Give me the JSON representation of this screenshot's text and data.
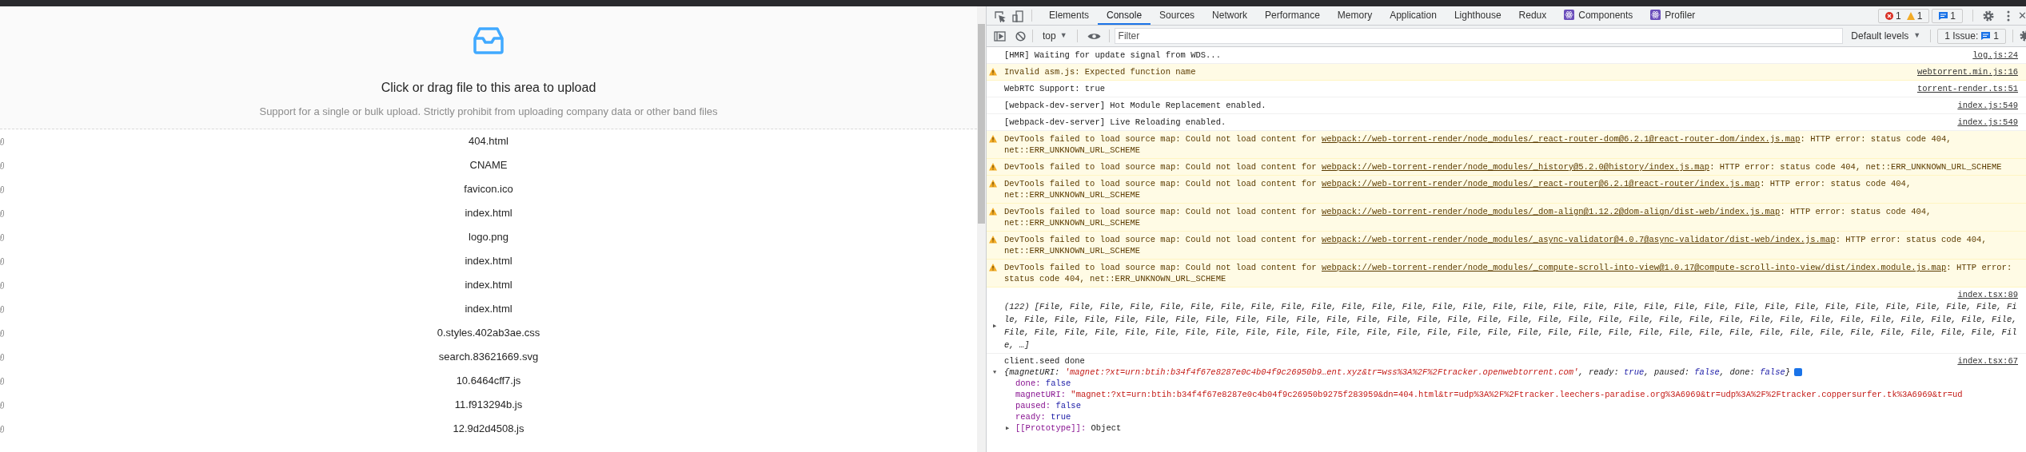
{
  "upload": {
    "title": "Click or drag file to this area to upload",
    "hint": "Support for a single or bulk upload. Strictly prohibit from uploading company data or other band files"
  },
  "files": [
    "404.html",
    "CNAME",
    "favicon.ico",
    "index.html",
    "logo.png",
    "index.html",
    "index.html",
    "index.html",
    "0.styles.402ab3ae.css",
    "search.83621669.svg",
    "10.6464cff7.js",
    "11.f913294b.js",
    "12.9d2d4508.js"
  ],
  "devtools": {
    "tabs": [
      {
        "label": "Elements",
        "kind": "plain",
        "selected": false
      },
      {
        "label": "Console",
        "kind": "plain",
        "selected": true
      },
      {
        "label": "Sources",
        "kind": "plain",
        "selected": false
      },
      {
        "label": "Network",
        "kind": "plain",
        "selected": false
      },
      {
        "label": "Performance",
        "kind": "plain",
        "selected": false
      },
      {
        "label": "Memory",
        "kind": "plain",
        "selected": false
      },
      {
        "label": "Application",
        "kind": "plain",
        "selected": false
      },
      {
        "label": "Lighthouse",
        "kind": "plain",
        "selected": false
      },
      {
        "label": "Redux",
        "kind": "plain",
        "selected": false
      },
      {
        "label": "Components",
        "kind": "react",
        "selected": false
      },
      {
        "label": "Profiler",
        "kind": "react",
        "selected": false
      }
    ],
    "counts": {
      "errors": "1",
      "warnings": "1",
      "messages": "1"
    },
    "toolbar": {
      "context": "top",
      "dropdown_caret": "▼",
      "filter_placeholder": "Filter",
      "levels": "Default levels",
      "issues_label": "1 Issue:",
      "issues_count": "1"
    },
    "close": "✕",
    "messages": [
      {
        "kind": "log",
        "text": "[HMR] Waiting for update signal from WDS...",
        "source": "log.js:24"
      },
      {
        "kind": "warning",
        "text": "Invalid asm.js: Expected function name",
        "source": "webtorrent.min.js:16"
      },
      {
        "kind": "log",
        "text": "WebRTC Support: true",
        "source": "torrent-render.ts:51"
      },
      {
        "kind": "log",
        "text": "[webpack-dev-server] Hot Module Replacement enabled.",
        "source": "index.js:549"
      },
      {
        "kind": "log",
        "text": "[webpack-dev-server] Live Reloading enabled.",
        "source": "index.js:549"
      },
      {
        "kind": "warning",
        "text": "DevTools failed to load source map: Could not load content for ",
        "link": "webpack://web-torrent-render/node_modules/_react-router-dom@6.2.1@react-router-dom/index.js.map",
        "after": ": HTTP error: status code 404, net::ERR_UNKNOWN_URL_SCHEME"
      },
      {
        "kind": "warning",
        "text": "DevTools failed to load source map: Could not load content for ",
        "link": "webpack://web-torrent-render/node_modules/_history@5.2.0@history/index.js.map",
        "after": ": HTTP error: status code 404, net::ERR_UNKNOWN_URL_SCHEME"
      },
      {
        "kind": "warning",
        "text": "DevTools failed to load source map: Could not load content for ",
        "link": "webpack://web-torrent-render/node_modules/_react-router@6.2.1@react-router/index.js.map",
        "after": ": HTTP error: status code 404, net::ERR_UNKNOWN_URL_SCHEME"
      },
      {
        "kind": "warning",
        "text": "DevTools failed to load source map: Could not load content for ",
        "link": "webpack://web-torrent-render/node_modules/_dom-align@1.12.2@dom-align/dist-web/index.js.map",
        "after": ": HTTP error: status code 404, net::ERR_UNKNOWN_URL_SCHEME"
      },
      {
        "kind": "warning",
        "text": "DevTools failed to load source map: Could not load content for ",
        "link": "webpack://web-torrent-render/node_modules/_async-validator@4.0.7@async-validator/dist-web/index.js.map",
        "after": ": HTTP error: status code 404, net::ERR_UNKNOWN_URL_SCHEME"
      },
      {
        "kind": "warning",
        "text": "DevTools failed to load source map: Could not load content for ",
        "link": "webpack://web-torrent-render/node_modules/_compute-scroll-into-view@1.0.17@compute-scroll-into-view/dist/index.module.js.map",
        "after": ": HTTP error: status code 404, net::ERR_UNKNOWN_URL_SCHEME"
      },
      {
        "kind": "array",
        "toggle": "▶",
        "text": "(122) [File, File, File, File, File, File, File, File, File, File, File, File, File, File, File, File, File, File, File, File, File, File, File, File, File, File, File, File, File, File, File, File, File, File, File, File, File, File, File, File, File, File, File, File, File, File, File, File, File, File, File, File, File, File, File, File, File, File, File, File, File, File, File, File, File, File, File, File, File, File, File, File, File, File, File, File, File, File, File, File, File, File, File, File, File, File, File, File, File, File, File, File, File, File, File, File, File, File, File, File, …]",
        "source": "index.tsx:89"
      },
      {
        "kind": "object",
        "text": "client.seed done",
        "source": "index.tsx:67",
        "toggle": "▼",
        "preview": [
          {
            "text": "{magnetURI: ",
            "kind": "plain"
          },
          {
            "text": "'magnet:?xt=urn:btih:b34f4f67e8287e0c4b04f9c26950b9…ent.xyz&tr=wss%3A%2F%2Ftracker.openwebtorrent.com'",
            "kind": "string"
          },
          {
            "text": ", ready: ",
            "kind": "plain"
          },
          {
            "text": "true",
            "kind": "boolean"
          },
          {
            "text": ", paused: ",
            "kind": "plain"
          },
          {
            "text": "false",
            "kind": "boolean"
          },
          {
            "text": ", done: ",
            "kind": "plain"
          },
          {
            "text": "false",
            "kind": "boolean"
          },
          {
            "text": "}",
            "kind": "plain"
          }
        ],
        "properties": [
          {
            "key": "done:",
            "value": "false",
            "kind": "boolean"
          },
          {
            "key": "magnetURI:",
            "value": "\"magnet:?xt=urn:btih:b34f4f67e8287e0c4b04f9c26950b9275f283959&dn=404.html&tr=udp%3A%2F%2Ftracker.leechers-paradise.org%3A6969&tr=udp%3A%2F%2Ftracker.coppersurfer.tk%3A6969&tr=ud",
            "kind": "string"
          },
          {
            "key": "paused:",
            "value": "false",
            "kind": "boolean"
          },
          {
            "key": "ready:",
            "value": "true",
            "kind": "boolean"
          }
        ],
        "prototype": {
          "toggle": "▶",
          "key": "[[Prototype]]:",
          "value": "Object"
        }
      }
    ]
  }
}
